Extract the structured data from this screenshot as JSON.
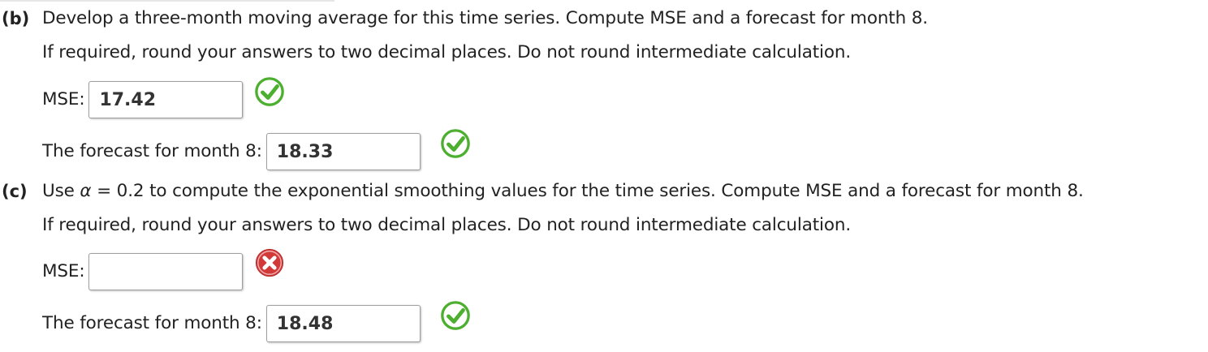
{
  "part_b": {
    "label": "(b)",
    "prompt": "Develop a three-month moving average for this time series. Compute MSE and a forecast for month 8.",
    "instruction": "If required, round your answers to two decimal places. Do not round intermediate calculation.",
    "mse": {
      "label": "MSE:",
      "value": "17.42",
      "status": "correct"
    },
    "forecast": {
      "label": "The forecast for month 8:",
      "value": "18.33",
      "status": "correct"
    }
  },
  "part_c": {
    "label": "(c)",
    "prompt_prefix": "Use ",
    "prompt_alpha": "α",
    "prompt_suffix": " = 0.2 to compute the exponential smoothing values for the time series. Compute MSE and a forecast for month 8.",
    "instruction": "If required, round your answers to two decimal places. Do not round intermediate calculation.",
    "mse": {
      "label": "MSE:",
      "value": "",
      "status": "incorrect"
    },
    "forecast": {
      "label": "The forecast for month 8:",
      "value": "18.48",
      "status": "correct"
    }
  },
  "colors": {
    "correct": "#4caf2f",
    "incorrect": "#d23a3a"
  },
  "icons": {
    "correct": "check-circle-icon",
    "incorrect": "x-circle-icon"
  }
}
